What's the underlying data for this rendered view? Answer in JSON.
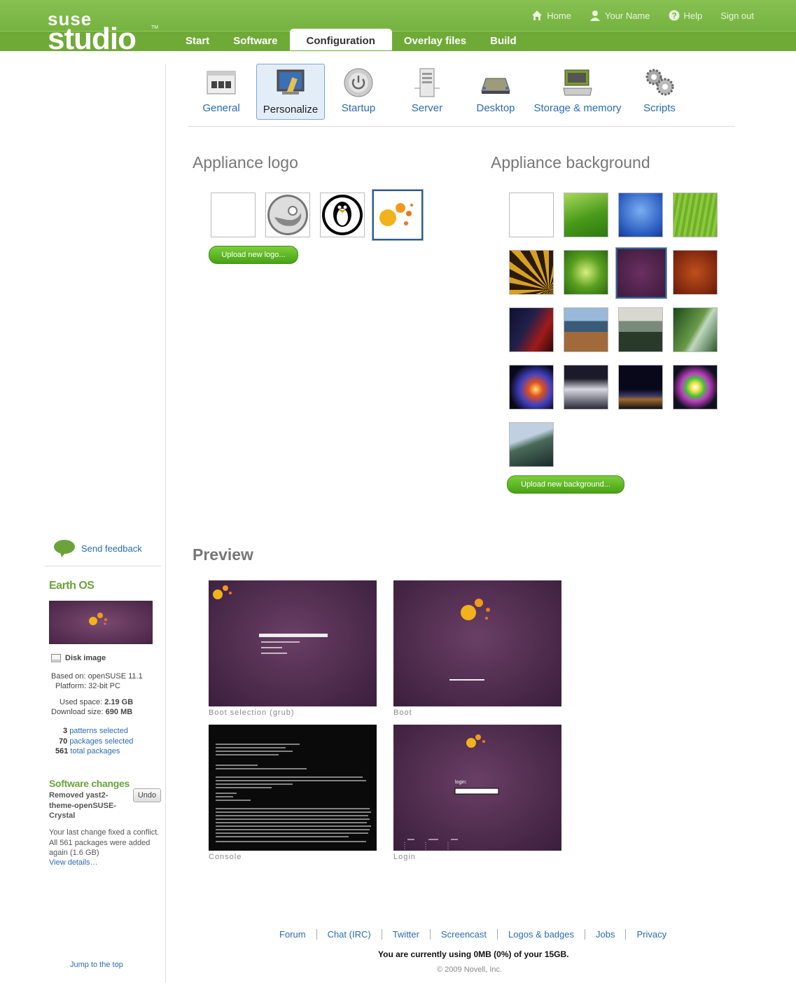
{
  "header": {
    "logo_top": "suse",
    "logo_bottom": "studio",
    "logo_tm": "TM",
    "links": {
      "home": "Home",
      "user": "Your Name",
      "help": "Help",
      "signout": "Sign out"
    },
    "tabs": [
      "Start",
      "Software",
      "Configuration",
      "Overlay files",
      "Build"
    ],
    "active_tab": "Configuration"
  },
  "config_nav": {
    "items": [
      {
        "label": "General",
        "icon": "general-icon"
      },
      {
        "label": "Personalize",
        "icon": "personalize-icon"
      },
      {
        "label": "Startup",
        "icon": "startup-icon"
      },
      {
        "label": "Server",
        "icon": "server-icon"
      },
      {
        "label": "Desktop",
        "icon": "desktop-icon"
      },
      {
        "label": "Storage & memory",
        "icon": "storage-icon"
      },
      {
        "label": "Scripts",
        "icon": "scripts-icon"
      }
    ],
    "active": "Personalize"
  },
  "logo_section": {
    "title": "Appliance logo",
    "upload_label": "Upload new logo...",
    "options": [
      "blank",
      "opensuse-gecko",
      "tux-penguin",
      "orange-bubbles"
    ],
    "selected": "orange-bubbles"
  },
  "background_section": {
    "title": "Appliance background",
    "upload_label": "Upload new background...",
    "selected": "purple-texture",
    "options": [
      "white",
      "green-wave",
      "blue-glow",
      "green-stripes",
      "golden-rays",
      "green-abstract",
      "purple-texture",
      "red-orange",
      "red-light-streaks",
      "coast-cliffs",
      "stormy-valley",
      "waterfall-forest",
      "rainbow-nebula",
      "mountain-peak",
      "night-horizon",
      "colorful-burst",
      "river-landscape"
    ]
  },
  "preview": {
    "title": "Preview",
    "captions": [
      "Boot selection (grub)",
      "Boot",
      "Console",
      "Login"
    ],
    "login_label": "login:"
  },
  "sidebar": {
    "feedback_label": "Send feedback",
    "appliance_name": "Earth OS",
    "disk_image_label": "Disk image",
    "based_on_label": "Based on:",
    "based_on_value": "openSUSE 11.1",
    "platform_label": "Platform:",
    "platform_value": "32-bit PC",
    "used_space_label": "Used space:",
    "used_space_value": "2.19 GB",
    "download_size_label": "Download size:",
    "download_size_value": "690 MB",
    "patterns_count": "3",
    "patterns_label": "patterns selected",
    "packages_count": "70",
    "packages_label": "packages selected",
    "total_count": "561",
    "total_label": "total packages",
    "software_changes_title": "Software changes",
    "undo_label": "Undo",
    "change_text": "Removed yast2-theme-openSUSE-Crystal",
    "conflict_text": "Your last change fixed a conflict. All 561 packages were added again (1.6 GB)",
    "view_details": "View details…",
    "jump_top": "Jump to the top"
  },
  "footer": {
    "links": [
      "Forum",
      "Chat (IRC)",
      "Twitter",
      "Screencast",
      "Logos & badges",
      "Jobs",
      "Privacy"
    ],
    "usage": "You are currently using 0MB (0%) of your 15GB.",
    "copyright": "© 2009 Novell, Inc."
  },
  "colors": {
    "brand_green": "#7fb84a",
    "link_blue": "#2a6bb5",
    "section_green": "#6aa33a",
    "selected_border": "#2d5d90"
  }
}
